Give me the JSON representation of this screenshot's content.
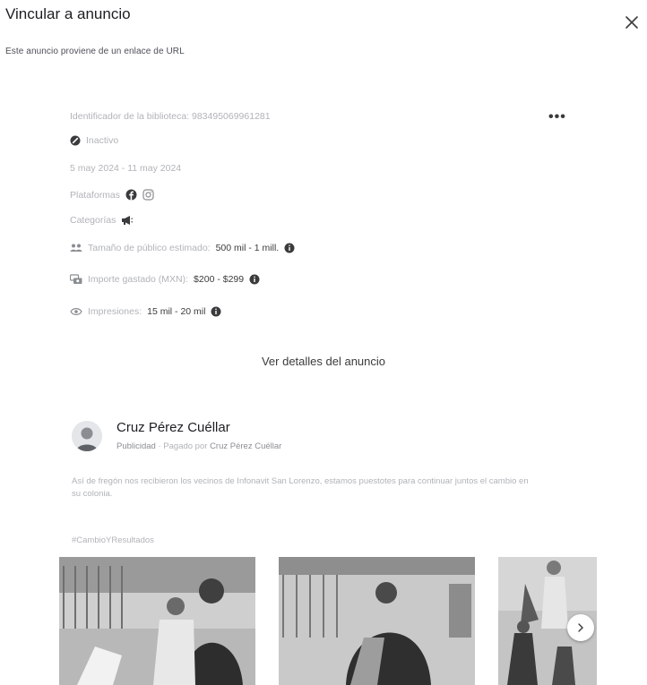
{
  "dialog": {
    "title": "Vincular a anuncio",
    "subtitle": "Este anuncio proviene de un enlace de URL"
  },
  "ad_info": {
    "library_id": "Identificador de la biblioteca: 983495069961281",
    "status": "Inactivo",
    "dates": "5 may 2024 - 11 may 2024",
    "platforms_label": "Plataformas",
    "categories_label": "Categorías",
    "audience_label": "Tamaño de público estimado:",
    "audience_value": "500 mil - 1 mill.",
    "spend_label": "Importe gastado (MXN):",
    "spend_value": "$200 - $299",
    "impressions_label": "Impresiones:",
    "impressions_value": "15 mil - 20 mil",
    "details_button": "Ver detalles del anuncio"
  },
  "ad": {
    "advertiser": "Cruz Pérez Cuéllar",
    "sponsored": "Publicidad",
    "paid_by_prefix": "· Pagado por",
    "paid_by": "Cruz Pérez Cuéllar",
    "text": "Así de fregón nos recibieron los vecinos de Infonavit San Lorenzo, estamos puestotes para continuar juntos el cambio en su colonia.",
    "hashtag": "#CambioYResultados"
  },
  "icons": {
    "close": "close-icon",
    "more": "more-options-icon",
    "status": "inactive-status-icon",
    "facebook": "facebook-icon",
    "instagram": "instagram-icon",
    "category": "megaphone-icon",
    "audience": "audience-icon",
    "spend": "money-icon",
    "impressions": "eye-icon",
    "info": "info-icon",
    "next": "chevron-right-icon"
  }
}
